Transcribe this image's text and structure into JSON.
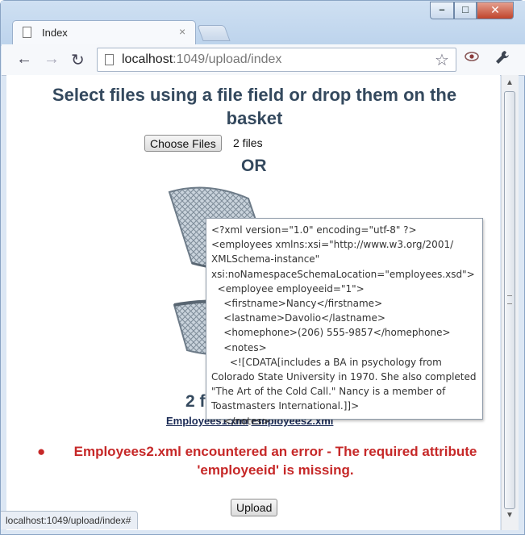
{
  "window": {
    "controls": {
      "minimize": "–",
      "maximize": "□",
      "close": "✕"
    }
  },
  "tab": {
    "title": "Index",
    "close": "×"
  },
  "toolbar": {
    "back": "←",
    "forward": "→",
    "reload": "↻",
    "url_host": "localhost",
    "url_rest": ":1049/upload/index",
    "star": "☆",
    "extension": "👁",
    "wrench": "🔧"
  },
  "page": {
    "heading": "Select files using a file field or drop them on the basket",
    "choose_button": "Choose Files",
    "file_count": "2 files",
    "or_label": "OR",
    "count_heading": "2 f",
    "files": [
      "Employees1.xml",
      "Employees2.xml"
    ],
    "error": "Employees2.xml encountered an error - The required attribute 'employeeid' is missing.",
    "upload_button": "Upload"
  },
  "tooltip": {
    "text": "<?xml version=\"1.0\" encoding=\"utf-8\" ?>\n<employees xmlns:xsi=\"http://www.w3.org/2001/\nXMLSchema-instance\"\nxsi:noNamespaceSchemaLocation=\"employees.xsd\">\n  <employee employeeid=\"1\">\n    <firstname>Nancy</firstname>\n    <lastname>Davolio</lastname>\n    <homephone>(206) 555-9857</homephone>\n    <notes>\n      <![CDATA[includes a BA in psychology from\nColorado State University in 1970. She also completed\n\"The Art of the Cold Call.\" Nancy is a member of\nToastmasters International.]]>\n    </notes>"
  },
  "status_bar": {
    "text": "localhost:1049/upload/index#"
  },
  "colors": {
    "heading": "#34495e",
    "error": "#c62828",
    "link": "#1a2a55"
  },
  "icons": [
    "page-icon",
    "back-icon",
    "forward-icon",
    "reload-icon",
    "star-icon",
    "extension-icon",
    "wrench-icon",
    "basket-icon"
  ]
}
